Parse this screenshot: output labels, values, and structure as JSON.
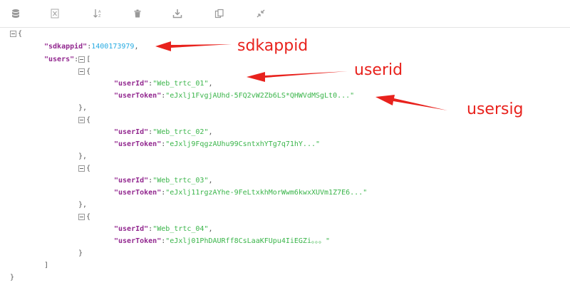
{
  "toolbar": {
    "buttons": [
      {
        "name": "database-icon"
      },
      {
        "name": "excel-icon"
      },
      {
        "name": "sort-icon"
      },
      {
        "name": "trash-icon"
      },
      {
        "name": "download-icon"
      },
      {
        "name": "copy-icon"
      },
      {
        "name": "collapse-icon"
      }
    ]
  },
  "json": {
    "open_brace": "{",
    "close_brace": "}",
    "sdkappid_key": "\"sdkappid\"",
    "sdkappid_value": "1400173979",
    "users_key": "\"users\"",
    "open_bracket": "[",
    "close_bracket": "]",
    "users": [
      {
        "userId_key": "\"userId\"",
        "userId": "\"Web_trtc_01\"",
        "userToken_key": "\"userToken\"",
        "userToken": "\"eJxlj1FvgjAUhd-5FQ2vW2Zb6LS*QHWVdMSgLt0...\""
      },
      {
        "userId_key": "\"userId\"",
        "userId": "\"Web_trtc_02\"",
        "userToken_key": "\"userToken\"",
        "userToken": "\"eJxlj9FqgzAUhu99CsntxhYTg7q71hY...\""
      },
      {
        "userId_key": "\"userId\"",
        "userId": "\"Web_trtc_03\"",
        "userToken_key": "\"userToken\"",
        "userToken": "\"eJxlj11rgzAYhe-9FeLtxkhMorWwm6kwxXUVm1Z7E6...\""
      },
      {
        "userId_key": "\"userId\"",
        "userId": "\"Web_trtc_04\"",
        "userToken_key": "\"userToken\"",
        "userToken": "\"eJxlj01PhDAURff8CsLaaKFUpu4IiEGZi。。。\""
      }
    ]
  },
  "annotations": {
    "sdkappid": "sdkappid",
    "userid": "userid",
    "usersig": "usersig"
  },
  "colors": {
    "key": "#92278f",
    "number": "#25aae2",
    "string": "#3ab54a",
    "annotation": "#e8221d"
  }
}
